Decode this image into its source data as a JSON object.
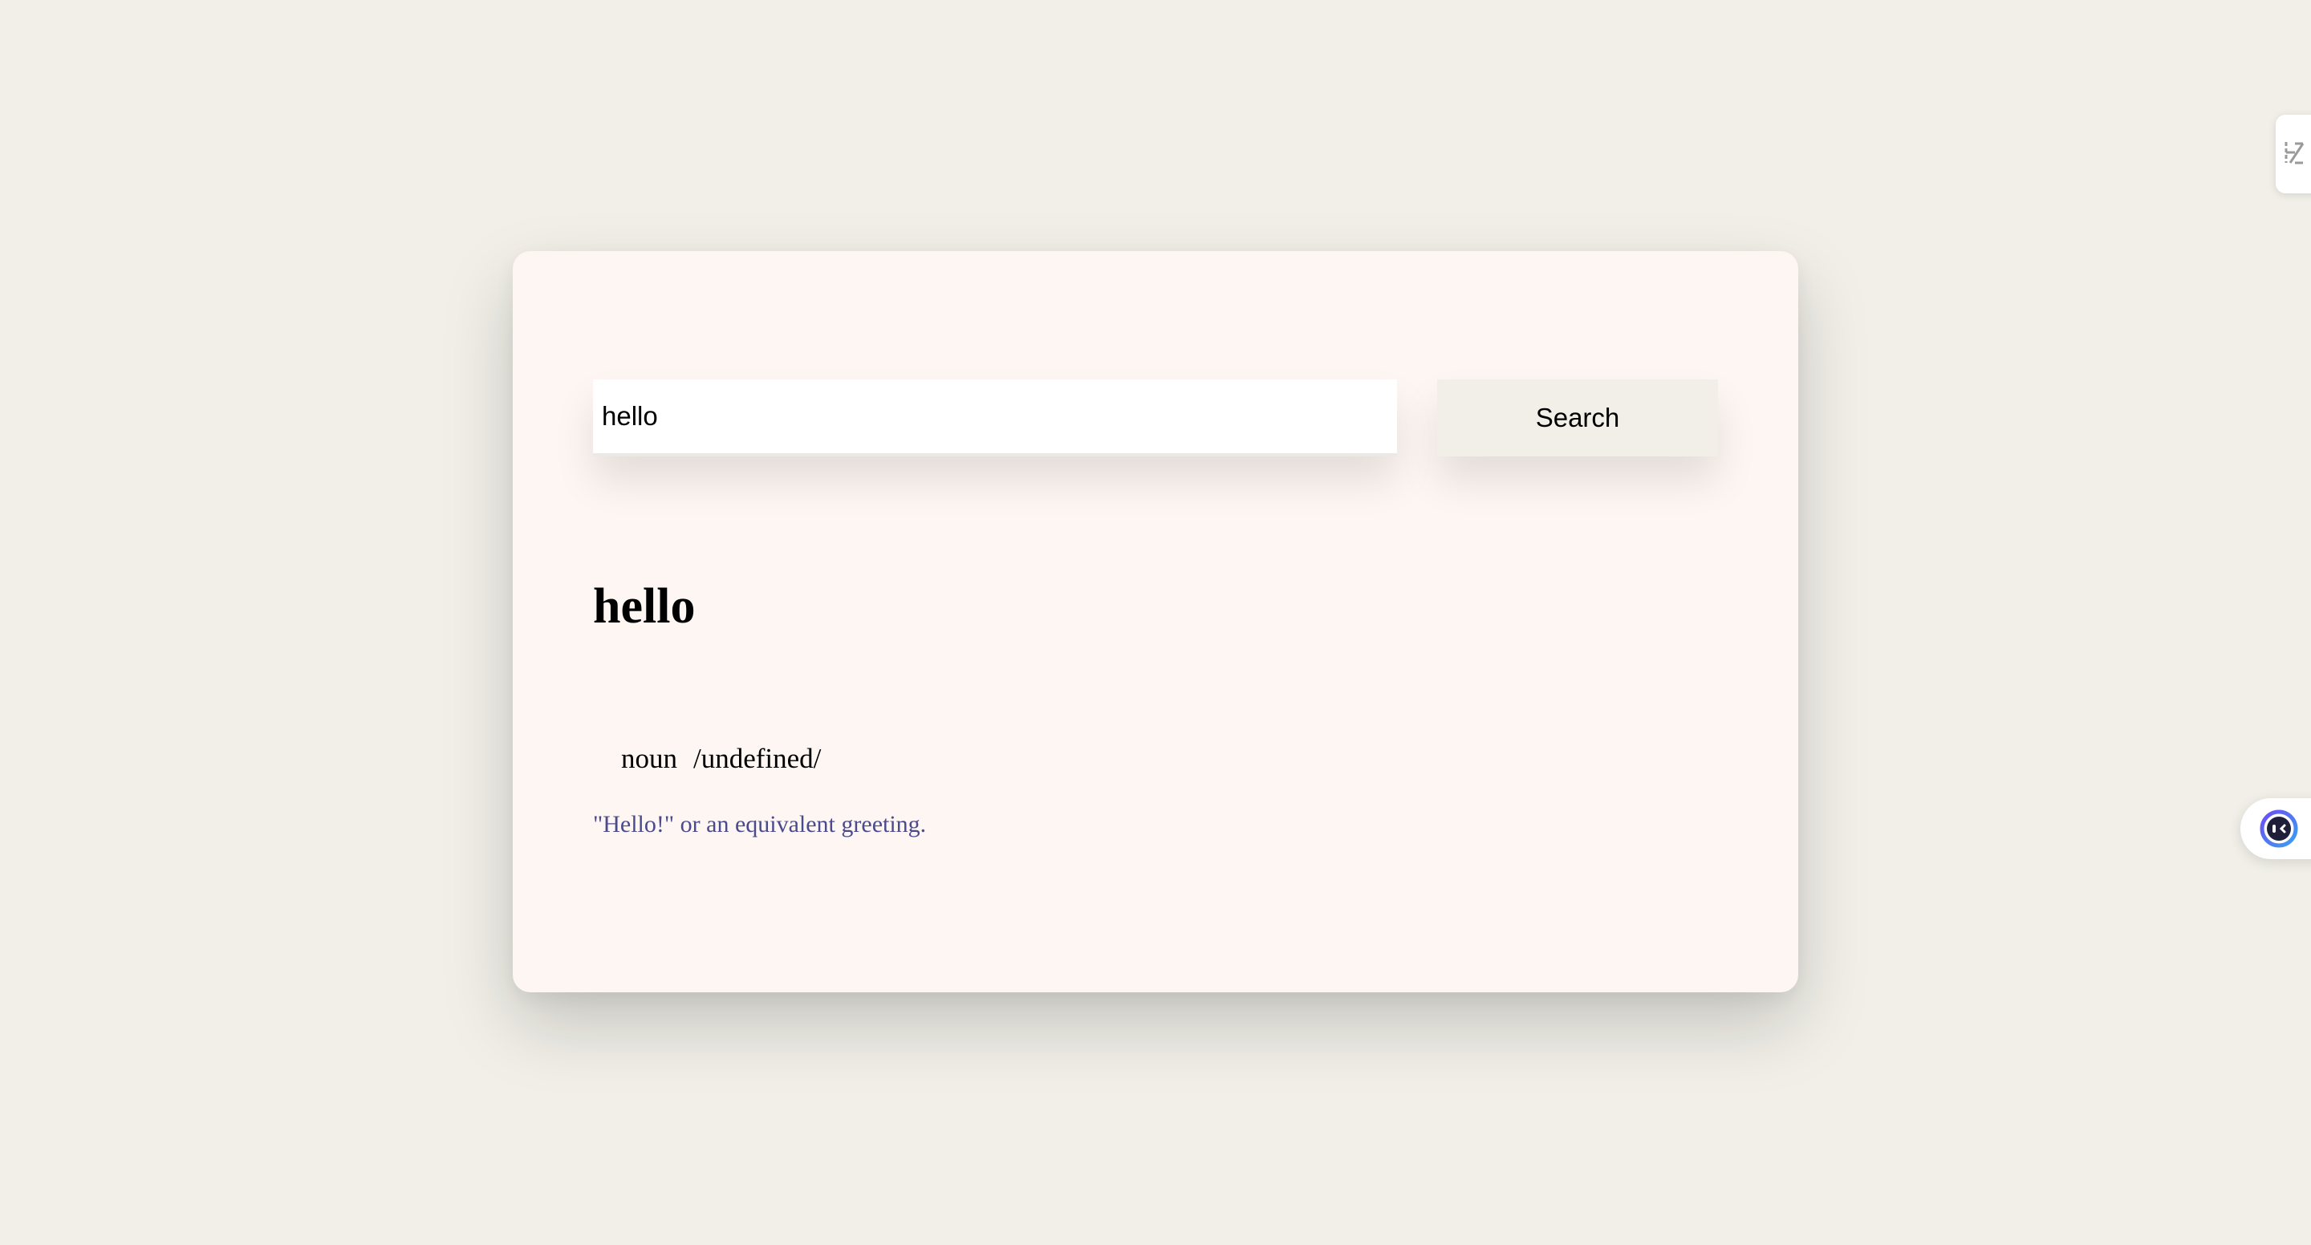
{
  "search": {
    "value": "hello",
    "button_label": "Search"
  },
  "entry": {
    "word": "hello",
    "part_of_speech": "noun",
    "phonetic": "/undefined/",
    "definition": "\"Hello!\" or an equivalent greeting."
  },
  "overlays": {
    "extension_tab_icon": "translate-icon",
    "assistant_icon": "assistant-face-icon"
  },
  "colors": {
    "page_background": "#f1efe8",
    "card_background": "#fdf6f2",
    "definition_text": "#4a4a8c",
    "button_background": "#f1efe8"
  }
}
